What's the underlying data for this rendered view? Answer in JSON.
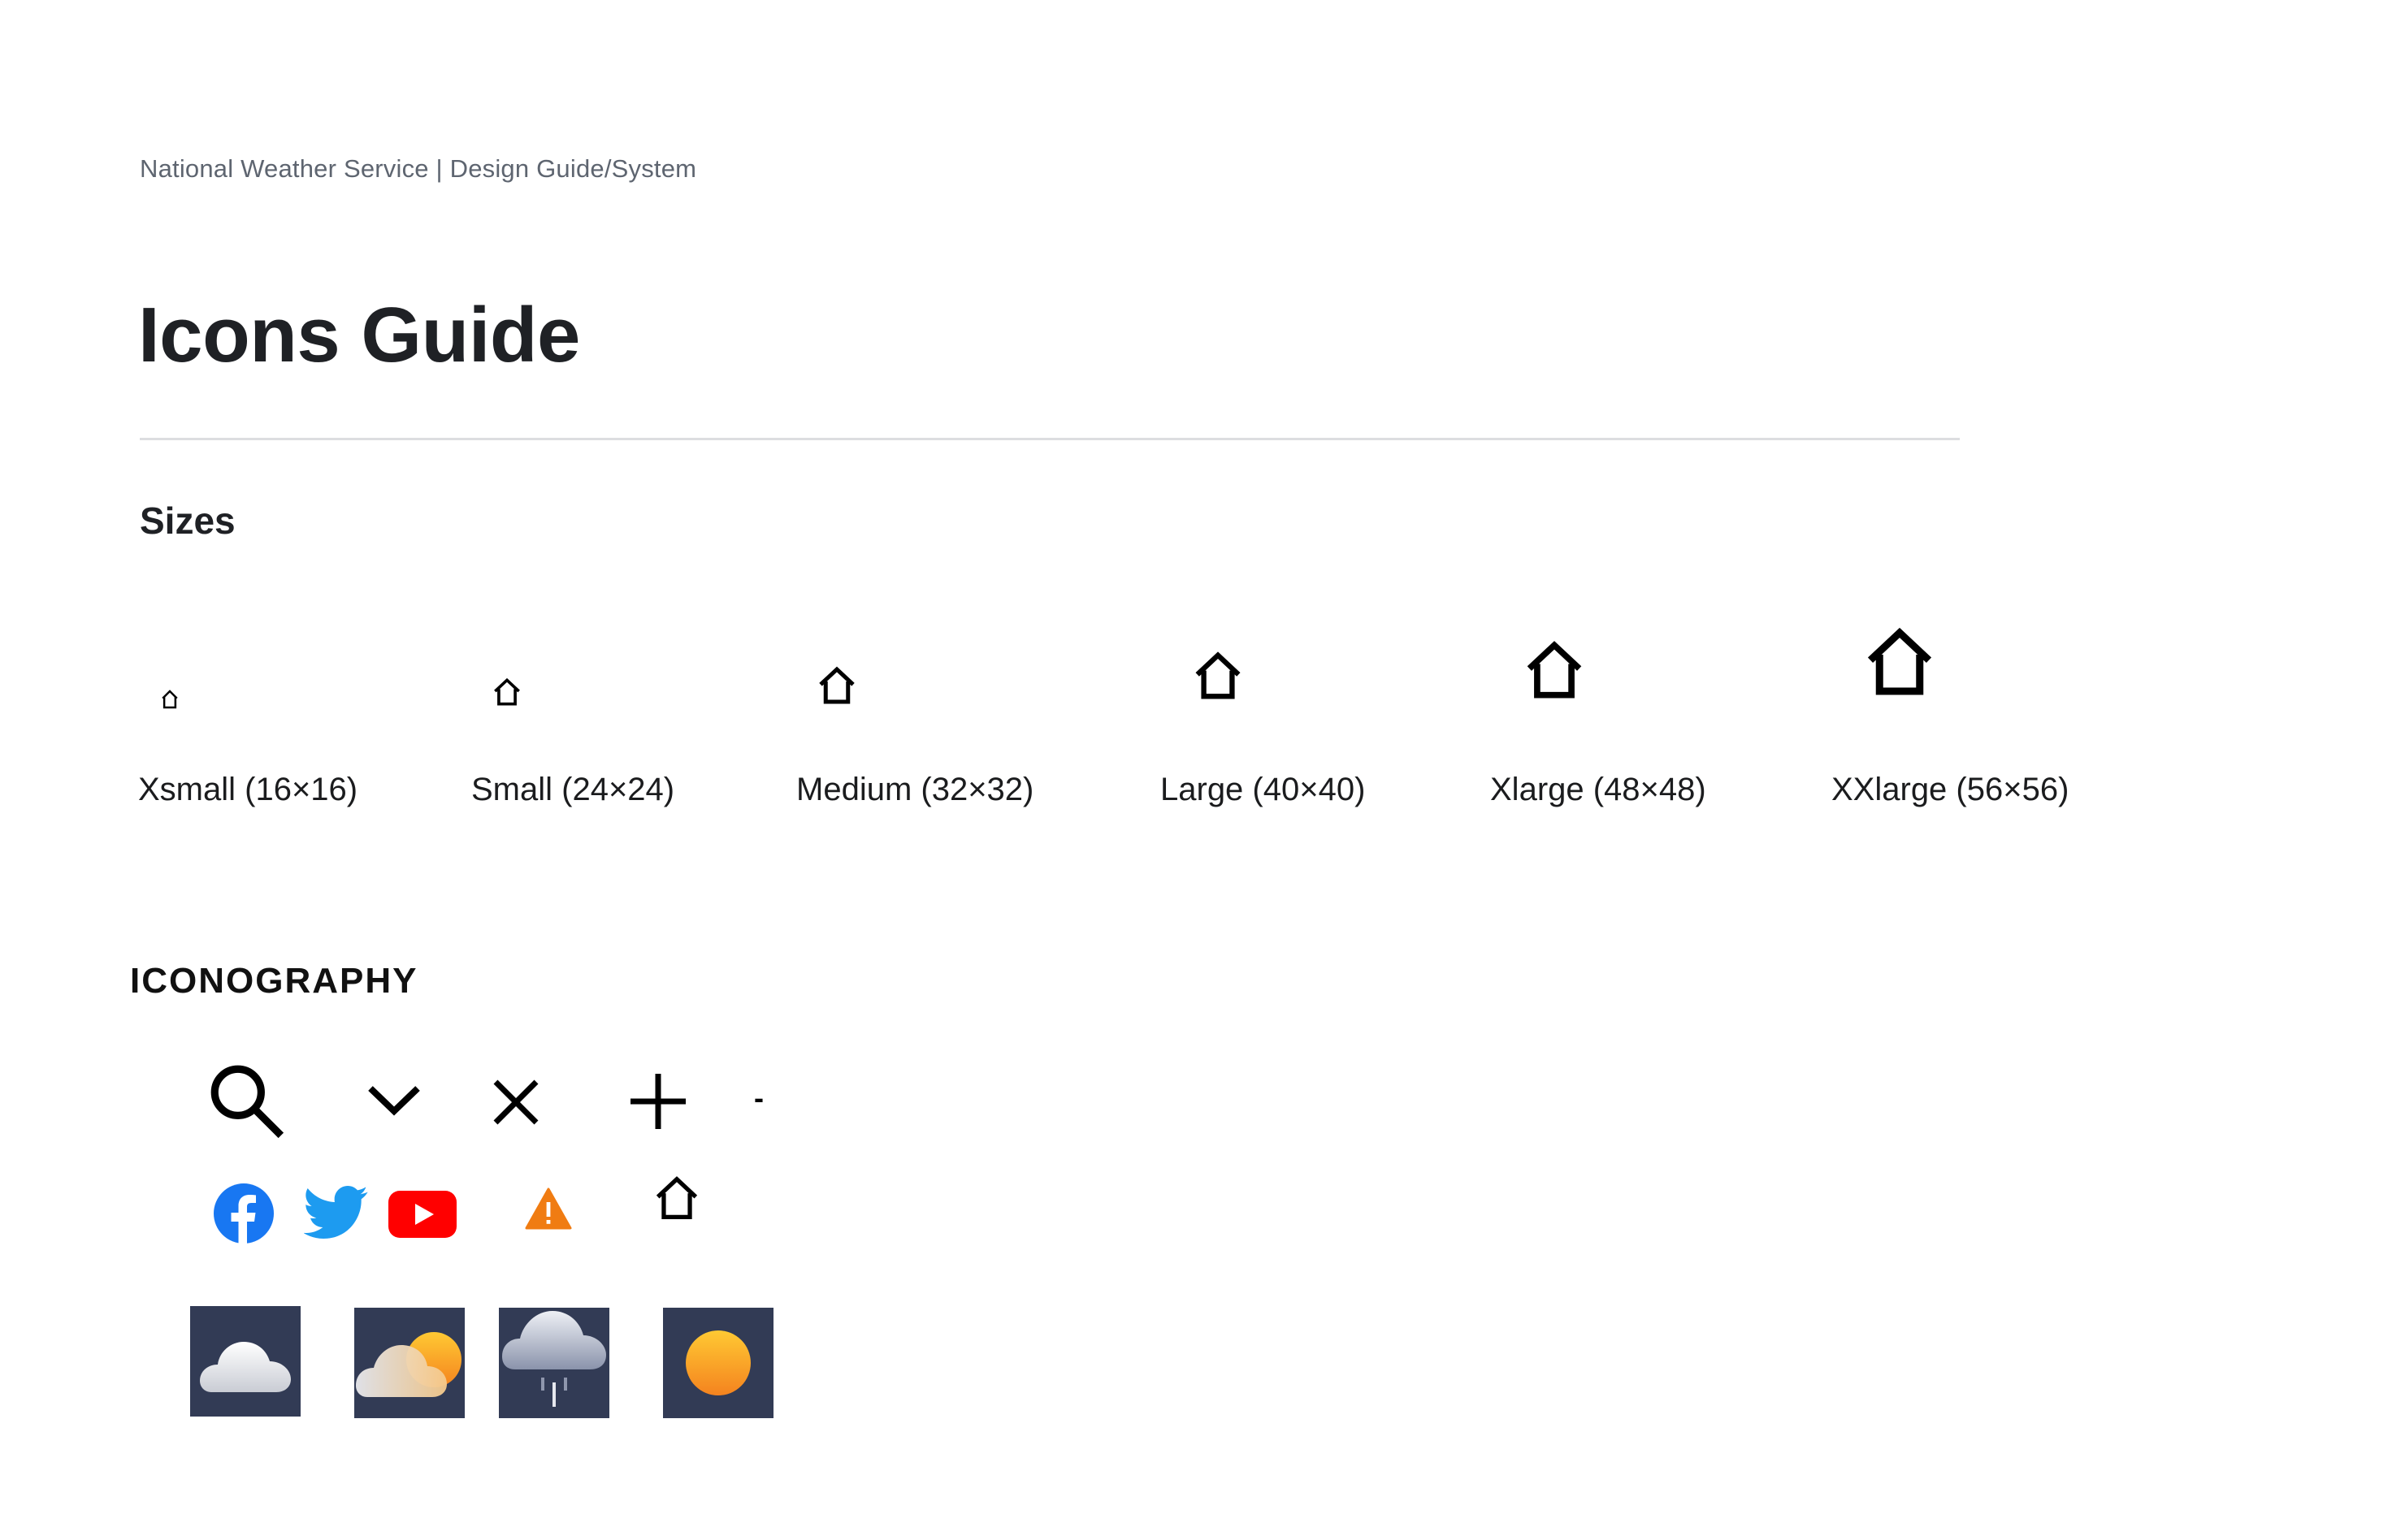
{
  "header": {
    "eyebrow": "National Weather Service | Design Guide/System",
    "title": "Icons Guide"
  },
  "sizes": {
    "heading": "Sizes",
    "items": [
      {
        "label": "Xsmall (16×16)",
        "icon": "home-icon"
      },
      {
        "label": "Small (24×24)",
        "icon": "home-icon"
      },
      {
        "label": "Medium (32×32)",
        "icon": "home-icon"
      },
      {
        "label": "Large (40×40)",
        "icon": "home-icon"
      },
      {
        "label": "Xlarge (48×48)",
        "icon": "home-icon"
      },
      {
        "label": "XXlarge (56×56)",
        "icon": "home-icon"
      }
    ]
  },
  "iconography": {
    "heading": "ICONOGRAPHY",
    "minus_glyph": "-",
    "ui_icons": [
      "search-icon",
      "chevron-down-icon",
      "close-icon",
      "plus-icon",
      "minus-icon"
    ],
    "social_icons": [
      "facebook-icon",
      "twitter-icon",
      "youtube-icon",
      "warning-icon",
      "home-icon"
    ],
    "weather_icons": [
      "cloudy-icon",
      "partly-cloudy-icon",
      "rain-icon",
      "sunny-icon"
    ]
  },
  "colors": {
    "title": "#1f2125",
    "eyebrow": "#5e6570",
    "divider": "#dcdde0",
    "tile_bg": "#323b55",
    "facebook": "#1877f2",
    "twitter": "#1d9bf0",
    "youtube": "#ff0000",
    "warning": "#f07c12",
    "sun": "#f7a21b"
  }
}
